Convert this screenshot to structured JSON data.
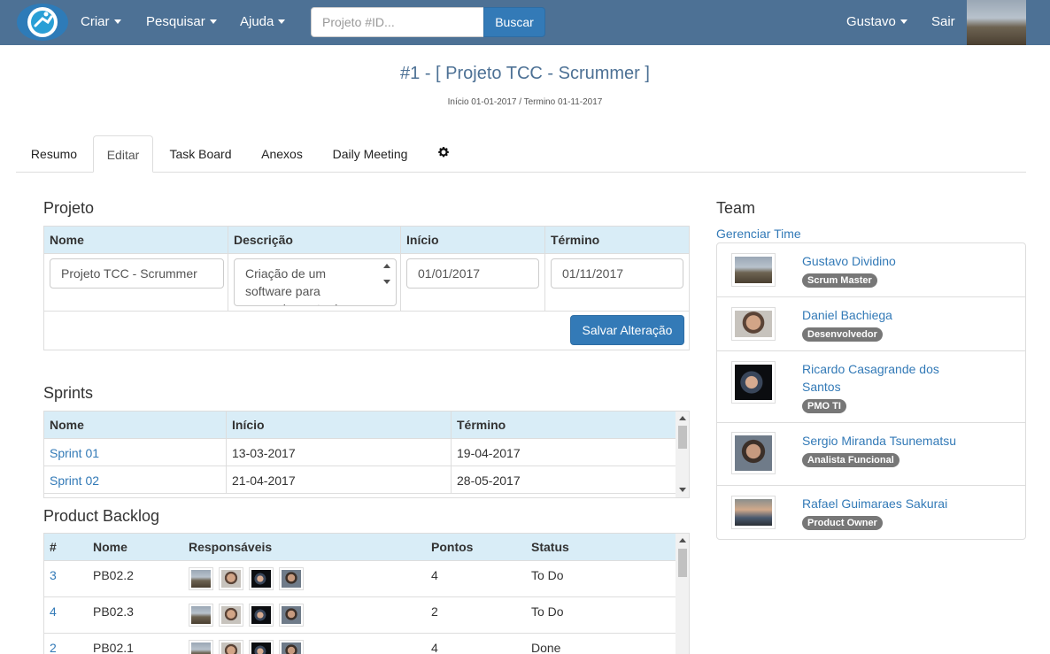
{
  "navbar": {
    "menu": [
      {
        "label": "Criar"
      },
      {
        "label": "Pesquisar"
      },
      {
        "label": "Ajuda"
      }
    ],
    "search_placeholder": "Projeto #ID...",
    "search_button": "Buscar",
    "user_label": "Gustavo",
    "logout_label": "Sair"
  },
  "project": {
    "title": "#1 - [ Projeto TCC - Scrummer ]",
    "dates": "Início 01-01-2017 / Termino 01-11-2017"
  },
  "tabs": [
    {
      "label": "Resumo",
      "active": false
    },
    {
      "label": "Editar",
      "active": true
    },
    {
      "label": "Task Board",
      "active": false
    },
    {
      "label": "Anexos",
      "active": false
    },
    {
      "label": "Daily Meeting",
      "active": false
    }
  ],
  "settings_icon": "gear-icon",
  "projeto": {
    "section_title": "Projeto",
    "headers": [
      "Nome",
      "Descrição",
      "Início",
      "Término"
    ],
    "nome": "Projeto TCC - Scrummer",
    "descricao": "Criação de um software para gerenciamento de projetos",
    "inicio": "01/01/2017",
    "termino": "01/11/2017",
    "save_button": "Salvar Alteração"
  },
  "sprints": {
    "section_title": "Sprints",
    "headers": [
      "Nome",
      "Início",
      "Término"
    ],
    "rows": [
      {
        "nome": "Sprint 01",
        "inicio": "13-03-2017",
        "termino": "19-04-2017"
      },
      {
        "nome": "Sprint 02",
        "inicio": "21-04-2017",
        "termino": "28-05-2017"
      }
    ]
  },
  "backlog": {
    "section_title": "Product Backlog",
    "headers": [
      "#",
      "Nome",
      "Responsáveis",
      "Pontos",
      "Status"
    ],
    "rows": [
      {
        "id": "3",
        "nome": "PB02.2",
        "pontos": "4",
        "status": "To Do"
      },
      {
        "id": "4",
        "nome": "PB02.3",
        "pontos": "2",
        "status": "To Do"
      },
      {
        "id": "2",
        "nome": "PB02.1",
        "pontos": "4",
        "status": "Done"
      }
    ]
  },
  "team": {
    "section_title": "Team",
    "manage_link": "Gerenciar Time",
    "members": [
      {
        "name": "Gustavo Dividino",
        "role": "Scrum Master"
      },
      {
        "name": "Daniel Bachiega",
        "role": "Desenvolvedor"
      },
      {
        "name": "Ricardo Casagrande dos Santos",
        "role": "PMO TI"
      },
      {
        "name": "Sergio Miranda Tsunematsu",
        "role": "Analista Funcional"
      },
      {
        "name": "Rafael Guimaraes Sakurai",
        "role": "Product Owner"
      }
    ]
  }
}
